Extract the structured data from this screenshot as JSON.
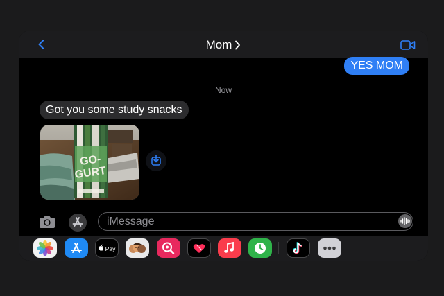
{
  "header": {
    "contact_name": "Mom",
    "back_icon": "chevron-left-icon",
    "video_icon": "video-camera-icon",
    "accent_color": "#2f7ff5"
  },
  "messages": {
    "sent": [
      {
        "text": "YES MOM"
      }
    ],
    "timestamp": "Now",
    "received": [
      {
        "text": "Got you some study snacks"
      }
    ],
    "photo": {
      "package_label_line1": "GO-",
      "package_label_line2": "GURT"
    }
  },
  "compose": {
    "placeholder": "iMessage",
    "value": ""
  },
  "app_drawer": {
    "apps": [
      {
        "name": "Photos",
        "icon": "photos-icon"
      },
      {
        "name": "App Store",
        "icon": "app-store-icon"
      },
      {
        "name": "Apple Pay",
        "icon": "apple-pay-icon",
        "label": "Pay"
      },
      {
        "name": "Memoji",
        "icon": "memoji-icon"
      },
      {
        "name": "Search Images",
        "icon": "search-images-icon"
      },
      {
        "name": "Digital Touch",
        "icon": "digital-touch-icon"
      },
      {
        "name": "Music",
        "icon": "music-icon"
      },
      {
        "name": "Activity",
        "icon": "activity-icon"
      },
      {
        "name": "TikTok",
        "icon": "tiktok-icon"
      },
      {
        "name": "More",
        "icon": "more-icon"
      }
    ]
  }
}
